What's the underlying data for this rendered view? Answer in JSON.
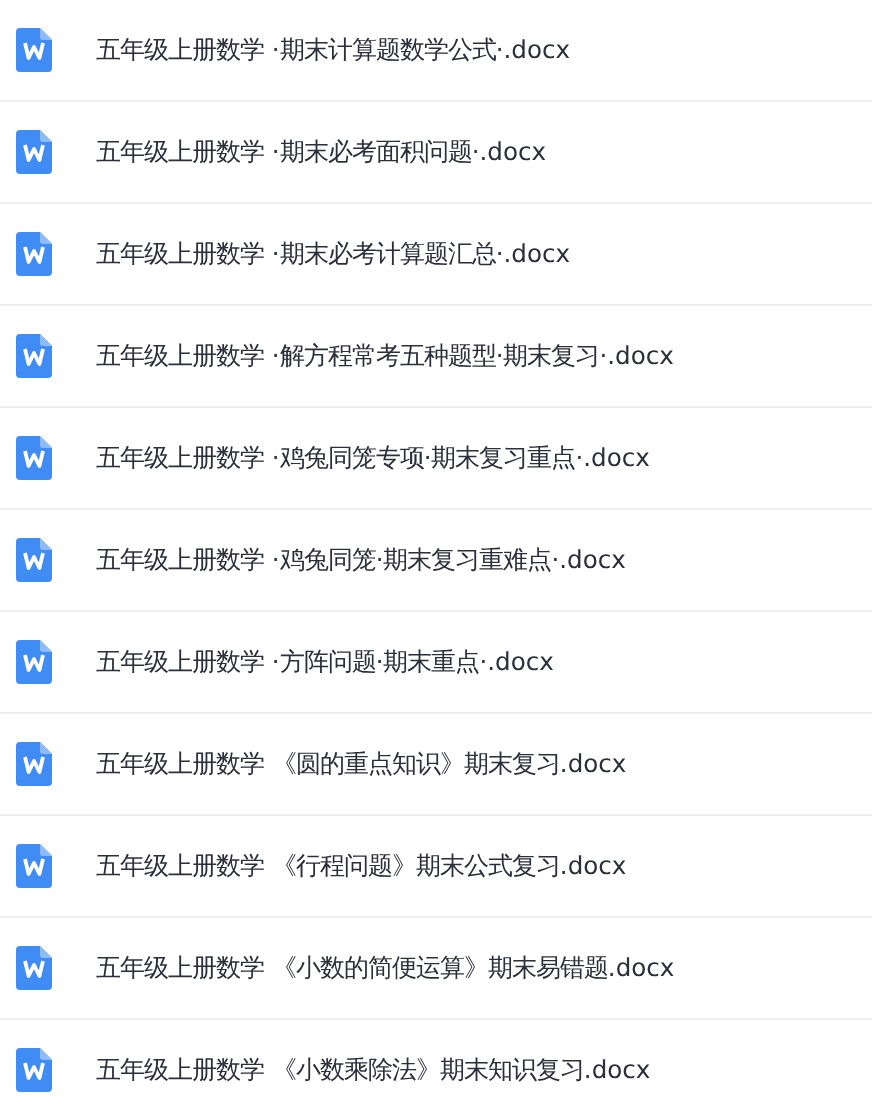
{
  "files": [
    {
      "name": "五年级上册数学 ·期末计算题数学公式·.docx"
    },
    {
      "name": "五年级上册数学 ·期末必考面积问题·.docx"
    },
    {
      "name": "五年级上册数学 ·期末必考计算题汇总·.docx"
    },
    {
      "name": "五年级上册数学 ·解方程常考五种题型·期末复习·.docx"
    },
    {
      "name": "五年级上册数学 ·鸡兔同笼专项·期末复习重点·.docx"
    },
    {
      "name": "五年级上册数学 ·鸡兔同笼·期末复习重难点·.docx"
    },
    {
      "name": "五年级上册数学 ·方阵问题·期末重点·.docx"
    },
    {
      "name": "五年级上册数学 《圆的重点知识》期末复习.docx"
    },
    {
      "name": "五年级上册数学 《行程问题》期末公式复习.docx"
    },
    {
      "name": "五年级上册数学 《小数的简便运算》期末易错题.docx"
    },
    {
      "name": "五年级上册数学 《小数乘除法》期末知识复习.docx"
    }
  ]
}
